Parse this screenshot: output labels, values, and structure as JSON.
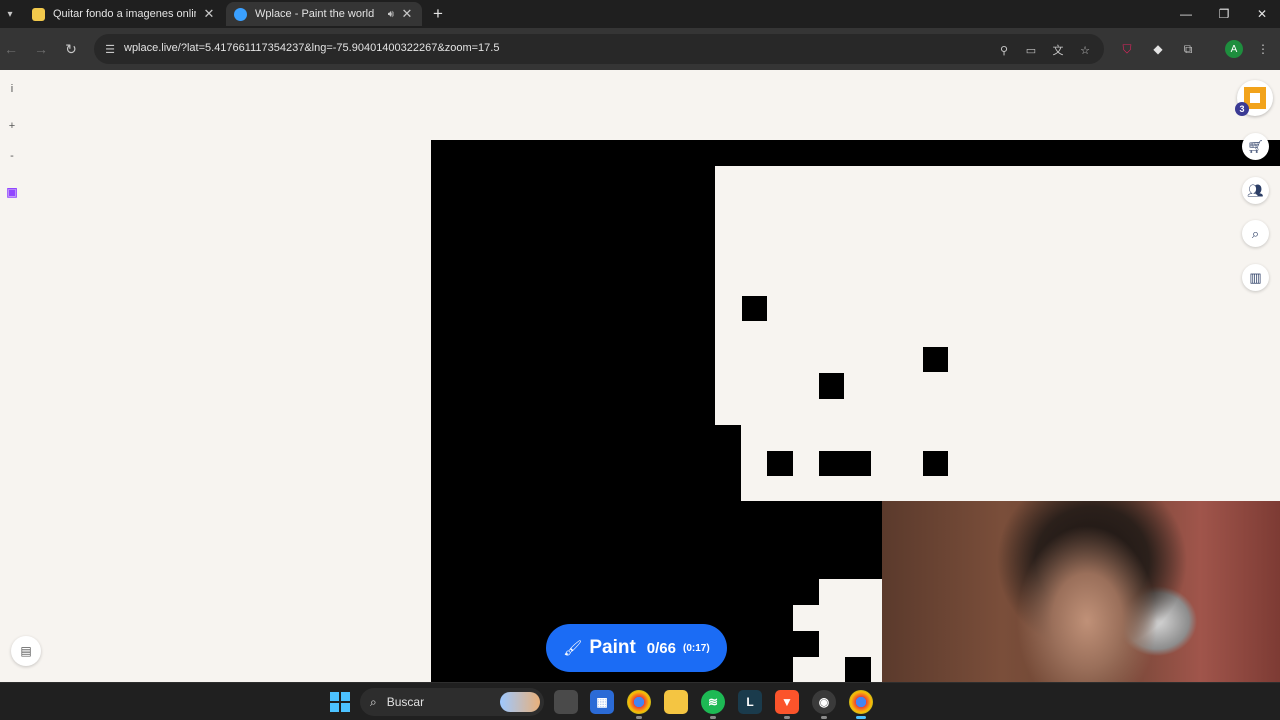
{
  "browser": {
    "tabs": [
      {
        "title": "Quitar fondo a imagenes online",
        "favicon_color": "#f2c94c"
      },
      {
        "title": "Wplace - Paint the world",
        "favicon_color": "#3aa0ff",
        "active": true,
        "audio": true
      }
    ],
    "url": "wplace.live/?lat=5.417661117354237&lng=-75.90401400322267&zoom=17.5",
    "profile_initial": "A"
  },
  "app": {
    "left_controls": {
      "info": "i",
      "zoom_in": "+",
      "zoom_out": "-"
    },
    "user_level": "3",
    "paint_button": {
      "label": "Paint",
      "count": "0/66",
      "timer": "(0:17)"
    },
    "accent_color": "#1b6cf5"
  },
  "taskbar": {
    "search_placeholder": "Buscar",
    "apps": [
      "file-explorer-window",
      "store",
      "chrome",
      "files",
      "spotify",
      "league",
      "brave",
      "obs",
      "chrome-active"
    ]
  }
}
